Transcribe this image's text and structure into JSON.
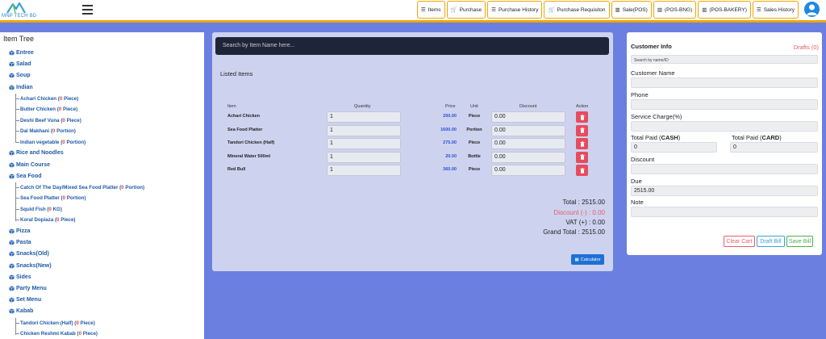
{
  "header": {
    "logo_text": "MNP TECH BD",
    "nav": [
      {
        "label": "Items",
        "icon": "list-icon"
      },
      {
        "label": "Purchase",
        "icon": "cart-icon"
      },
      {
        "label": "Purchase History",
        "icon": "list-icon"
      },
      {
        "label": "Purchase Requisiton",
        "icon": "cart-icon"
      },
      {
        "label": "Sale(POS)",
        "icon": "barcode-icon"
      },
      {
        "label": "(POS-BNG)",
        "icon": "barcode-icon"
      },
      {
        "label": "(POS-BAKERY)",
        "icon": "barcode-icon"
      },
      {
        "label": "Sales History",
        "icon": "list-icon"
      }
    ]
  },
  "tree": {
    "title": "Item Tree",
    "items": [
      {
        "label": "Entree"
      },
      {
        "label": "Salad"
      },
      {
        "label": "Soup"
      },
      {
        "label": "Indian",
        "children": [
          {
            "name": "Achari Chicken",
            "qty": "0",
            "unit": "Piece"
          },
          {
            "name": "Butter Chicken",
            "qty": "0",
            "unit": "Piece"
          },
          {
            "name": "Deshi Beef Vuna",
            "qty": "0",
            "unit": "Piece"
          },
          {
            "name": "Dal Makhani",
            "qty": "0",
            "unit": "Portion"
          },
          {
            "name": "Indian vegetable",
            "qty": "0",
            "unit": "Portion"
          }
        ]
      },
      {
        "label": "Rice and Noodles"
      },
      {
        "label": "Main Course"
      },
      {
        "label": "Sea Food",
        "children": [
          {
            "name": "Catch Of The Day/Mixed Sea Food Platter",
            "qty": "0",
            "unit": "Portion"
          },
          {
            "name": "Sea Food Platter",
            "qty": "0",
            "unit": "Portion"
          },
          {
            "name": "Squid Fish",
            "qty": "0",
            "unit": "KG"
          },
          {
            "name": "Koral Dopiaza",
            "qty": "0",
            "unit": "Piece"
          }
        ]
      },
      {
        "label": "Pizza"
      },
      {
        "label": "Pasta"
      },
      {
        "label": "Snacks(Old)"
      },
      {
        "label": "Snacks(New)"
      },
      {
        "label": "Sides"
      },
      {
        "label": "Party Menu"
      },
      {
        "label": "Set Menu"
      },
      {
        "label": "Kabab",
        "children": [
          {
            "name": "Tandori Chicken (Half)",
            "qty": "0",
            "unit": "Piece"
          },
          {
            "name": "Chicken Reshmi Kabab",
            "qty": "0",
            "unit": "Piece"
          }
        ]
      }
    ]
  },
  "cart": {
    "search_placeholder": "Search by Item Name here...",
    "listed_title": "Listed Items",
    "columns": {
      "item": "Item",
      "quantity": "Quantity",
      "price": "Price",
      "unit": "Unit",
      "discount": "Discount",
      "action": "Action"
    },
    "rows": [
      {
        "item": "Achari Chicken",
        "quantity": "1",
        "price": "260.00",
        "unit": "Piece",
        "discount": "0.00"
      },
      {
        "item": "Sea Food Platter",
        "quantity": "1",
        "price": "1600.00",
        "unit": "Portion",
        "discount": "0.00"
      },
      {
        "item": "Tandori Chicken (Half)",
        "quantity": "1",
        "price": "275.00",
        "unit": "Piece",
        "discount": "0.00"
      },
      {
        "item": "Mineral Water 500ml",
        "quantity": "1",
        "price": "20.00",
        "unit": "Bottle",
        "discount": "0.00"
      },
      {
        "item": "Red Bull",
        "quantity": "1",
        "price": "360.00",
        "unit": "Piece",
        "discount": "0.00"
      }
    ],
    "total": "Total : 2515.00",
    "discount": "Discount (-) : 0.00",
    "vat": "VAT (+) : 0.00",
    "grand_total": "Grand Total : 2515.00",
    "calculator_label": "Calculator"
  },
  "customer": {
    "title": "Customer Info",
    "drafts": "Drafts (0)",
    "search_placeholder": "Search by name/ID",
    "name_label": "Customer Name",
    "phone_label": "Phone",
    "service_label": "Service Charge(%)",
    "paid_cash_prefix": "Total Paid (",
    "paid_cash_bold": "CASH",
    "paid_card_prefix": "Total Paid (",
    "paid_card_bold": "CARD",
    "suffix": ")",
    "paid_cash_value": "0",
    "paid_card_value": "0",
    "discount_label": "Discount",
    "due_label": "Due",
    "due_value": "2515.00",
    "note_label": "Note",
    "clear_cart": "Clear Cart",
    "draft_bill": "Draft Bill",
    "save_bill": "Save Bill"
  },
  "colors": {
    "accent": "#f0a500",
    "background": "#6b7fe0",
    "danger": "#e74c5e",
    "primary": "#1f6fd6"
  }
}
